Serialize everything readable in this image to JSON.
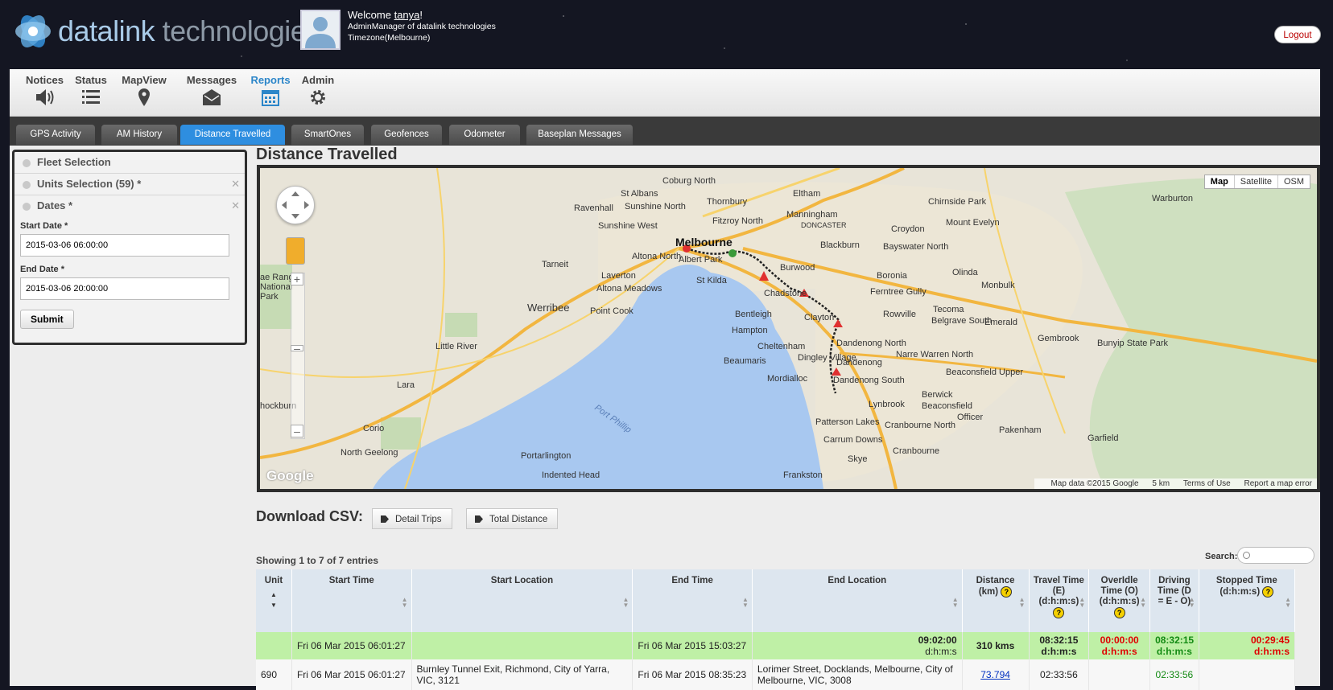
{
  "header": {
    "logo_part1": "datalink",
    "logo_part2": "technologies",
    "welcome_prefix": "Welcome",
    "username": "tanya",
    "welcome_suffix": "!",
    "role": "AdminManager of datalink technologies",
    "timezone": "Timezone(Melbourne)",
    "logout": "Logout"
  },
  "nav": [
    {
      "label": "Notices",
      "icon": "speaker-icon"
    },
    {
      "label": "Status",
      "icon": "list-icon"
    },
    {
      "label": "MapView",
      "icon": "map-pin-icon"
    },
    {
      "label": "Messages",
      "icon": "envelope-icon"
    },
    {
      "label": "Reports",
      "icon": "calendar-icon"
    },
    {
      "label": "Admin",
      "icon": "gear-icon"
    }
  ],
  "tabs": [
    "GPS Activity",
    "AM History",
    "Distance Travelled",
    "SmartOnes",
    "Geofences",
    "Odometer",
    "Baseplan Messages"
  ],
  "active_tab": "Distance Travelled",
  "sidebar": {
    "fleet_selection": "Fleet Selection",
    "units_selection": "Units Selection (59) *",
    "dates": "Dates *",
    "start_label": "Start Date *",
    "start_value": "2015-03-06 06:00:00",
    "end_label": "End Date *",
    "end_value": "2015-03-06 20:00:00",
    "submit": "Submit"
  },
  "page_title": "Distance Travelled",
  "map": {
    "types": [
      "Map",
      "Satellite",
      "OSM"
    ],
    "attribution": "Map data ©2015 Google",
    "scale": "5 km",
    "terms": "Terms of Use",
    "report": "Report a map error",
    "google": "Google",
    "labels": {
      "melbourne": "Melbourne",
      "coburg_north": "Coburg North",
      "thornbury": "Thornbury",
      "eltham": "Eltham",
      "st_albans": "St Albans",
      "sunshine_north": "Sunshine North",
      "sunshine_west": "Sunshine West",
      "ravenhall": "Ravenhall",
      "fitzroy_north": "Fitzroy North",
      "manningham": "Manningham",
      "doncaster": "DONCASTER",
      "chirnside_park": "Chirnside Park",
      "warburton": "Warburton",
      "croydon": "Croydon",
      "mount_evelyn": "Mount Evelyn",
      "bayswater_north": "Bayswater North",
      "blackburn": "Blackburn",
      "tarneit": "Tarneit",
      "laverton": "Laverton",
      "altona_north": "Altona North",
      "albert_park": "Albert Park",
      "burwood": "Burwood",
      "boronia": "Boronia",
      "olinda": "Olinda",
      "monbulk": "Monbulk",
      "st_kilda": "St Kilda",
      "altona_meadows": "Altona Meadows",
      "chadstone": "Chadstone",
      "ferntree_gully": "Ferntree Gully",
      "werribee": "Werribee",
      "point_cook": "Point Cook",
      "bentleigh": "Bentleigh",
      "clayton": "Clayton",
      "rowville": "Rowville",
      "tecoma": "Tecoma",
      "belgrave_south": "Belgrave South",
      "emerald": "Emerald",
      "hampton": "Hampton",
      "little_river": "Little River",
      "cheltenham": "Cheltenham",
      "dandenong_north": "Dandenong North",
      "narre_warren_north": "Narre Warren North",
      "gembrook": "Gembrook",
      "bunyip_state_park": "Bunyip State Park",
      "beaumaris": "Beaumaris",
      "dingley_village": "Dingley Village",
      "dandenong": "Dandenong",
      "beaconsfield_upper": "Beaconsfield Upper",
      "mordialloc": "Mordialloc",
      "lara": "Lara",
      "dandenong_south": "Dandenong South",
      "lynbrook": "Lynbrook",
      "berwick": "Berwick",
      "beaconsfield": "Beaconsfield",
      "officer": "Officer",
      "port_phillip": "Port Phillip",
      "hockburn": "hockburn",
      "corio": "Corio",
      "patterson_lakes": "Patterson Lakes",
      "cranbourne_north": "Cranbourne North",
      "pakenham": "Pakenham",
      "garfield": "Garfield",
      "north_geelong": "North Geelong",
      "carrum_downs": "Carrum Downs",
      "cranbourne": "Cranbourne",
      "portarlington": "Portarlington",
      "skye": "Skye",
      "indented_head": "Indented Head",
      "frankston": "Frankston",
      "ranges_park": "ae Ranges National Park"
    }
  },
  "csv": {
    "label": "Download CSV:",
    "detail": "Detail Trips",
    "total": "Total Distance"
  },
  "table": {
    "showing": "Showing 1 to 7 of 7 entries",
    "search_label": "Search:",
    "headers": {
      "unit": "Unit",
      "start_time": "Start Time",
      "start_location": "Start Location",
      "end_time": "End Time",
      "end_location": "End Location",
      "distance": "Distance (km)",
      "travel_time": "Travel Time (E) (d:h:m:s)",
      "overidle": "OverIdle Time (O) (d:h:m:s)",
      "driving": "Driving Time (D = E - O)",
      "stopped": "Stopped Time (d:h:m:s)"
    },
    "help": "?",
    "total": {
      "start_time": "Fri 06 Mar 2015 06:01:27",
      "end_time": "Fri 06 Mar 2015 15:03:27",
      "elapsed": "09:02:00",
      "elapsed_unit": "d:h:m:s",
      "distance": "310 kms",
      "travel": "08:32:15",
      "travel_unit": "d:h:m:s",
      "overidle": "00:00:00",
      "overidle_unit": "d:h:m:s",
      "driving": "08:32:15",
      "driving_unit": "d:h:m:s",
      "stopped": "00:29:45",
      "stopped_unit": "d:h:m:s"
    },
    "rows": [
      {
        "unit": "690",
        "start_time": "Fri 06 Mar 2015 06:01:27",
        "start_location": "Burnley Tunnel Exit, Richmond, City of Yarra, VIC, 3121",
        "end_time": "Fri 06 Mar 2015 08:35:23",
        "end_location": "Lorimer Street, Docklands, Melbourne, City of Melbourne, VIC, 3008",
        "distance": "73.794",
        "travel": "02:33:56",
        "driving": "02:33:56"
      }
    ]
  },
  "colors": {
    "accent": "#2e8ee0",
    "total_row": "#bff0a6",
    "alert_red": "#e00000",
    "ok_green": "#138a13"
  }
}
